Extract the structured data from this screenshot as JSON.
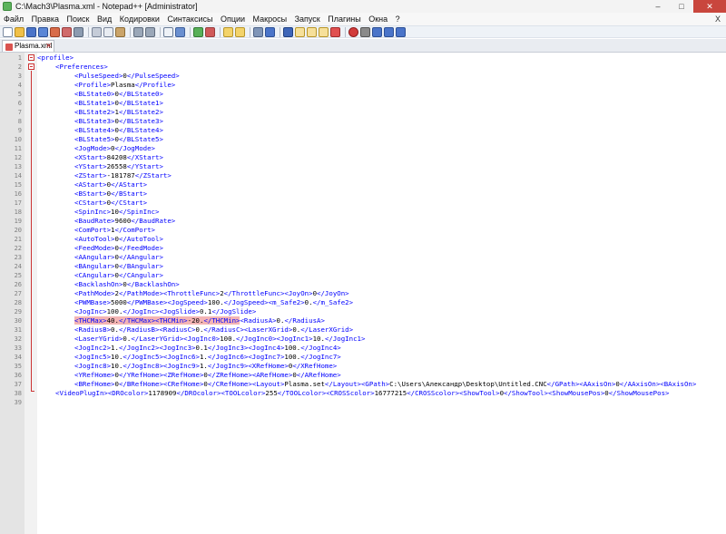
{
  "window": {
    "title": "C:\\Mach3\\Plasma.xml - Notepad++ [Administrator]",
    "buttons": [
      "–",
      "□",
      "✕"
    ]
  },
  "menu": {
    "items": [
      "Файл",
      "Правка",
      "Поиск",
      "Вид",
      "Кодировки",
      "Синтаксисы",
      "Опции",
      "Макросы",
      "Запуск",
      "Плагины",
      "Окна",
      "?"
    ],
    "close": "X"
  },
  "tab": {
    "label": "Plasma.xml",
    "close": "✕"
  },
  "colors": {
    "tag": "#0000ff",
    "text": "#000000",
    "highlight": "#f4b4b4",
    "fold": "#cc3333"
  },
  "lines": [
    {
      "num": "1",
      "segs": [
        [
          "t",
          "<profile>"
        ]
      ]
    },
    {
      "num": "2",
      "segs": [
        [
          "t",
          "<Preferences>"
        ]
      ]
    },
    {
      "num": "3",
      "segs": [
        [
          "t",
          "<PulseSpeed>"
        ],
        [
          "v",
          "0"
        ],
        [
          "t",
          "</PulseSpeed>"
        ]
      ]
    },
    {
      "num": "4",
      "segs": [
        [
          "t",
          "<Profile>"
        ],
        [
          "v",
          "Plasma"
        ],
        [
          "t",
          "</Profile>"
        ]
      ]
    },
    {
      "num": "5",
      "segs": [
        [
          "t",
          "<BLState0>"
        ],
        [
          "v",
          "0"
        ],
        [
          "t",
          "</BLState0>"
        ]
      ]
    },
    {
      "num": "6",
      "segs": [
        [
          "t",
          "<BLState1>"
        ],
        [
          "v",
          "0"
        ],
        [
          "t",
          "</BLState1>"
        ]
      ]
    },
    {
      "num": "7",
      "segs": [
        [
          "t",
          "<BLState2>"
        ],
        [
          "v",
          "1"
        ],
        [
          "t",
          "</BLState2>"
        ]
      ]
    },
    {
      "num": "8",
      "segs": [
        [
          "t",
          "<BLState3>"
        ],
        [
          "v",
          "0"
        ],
        [
          "t",
          "</BLState3>"
        ]
      ]
    },
    {
      "num": "9",
      "segs": [
        [
          "t",
          "<BLState4>"
        ],
        [
          "v",
          "0"
        ],
        [
          "t",
          "</BLState4>"
        ]
      ]
    },
    {
      "num": "10",
      "segs": [
        [
          "t",
          "<BLState5>"
        ],
        [
          "v",
          "0"
        ],
        [
          "t",
          "</BLState5>"
        ]
      ]
    },
    {
      "num": "11",
      "segs": [
        [
          "t",
          "<JogMode>"
        ],
        [
          "v",
          "0"
        ],
        [
          "t",
          "</JogMode>"
        ]
      ]
    },
    {
      "num": "12",
      "segs": [
        [
          "t",
          "<XStart>"
        ],
        [
          "v",
          "84208"
        ],
        [
          "t",
          "</XStart>"
        ]
      ]
    },
    {
      "num": "13",
      "segs": [
        [
          "t",
          "<YStart>"
        ],
        [
          "v",
          "26558"
        ],
        [
          "t",
          "</YStart>"
        ]
      ]
    },
    {
      "num": "14",
      "segs": [
        [
          "t",
          "<ZStart>"
        ],
        [
          "v",
          "-181787"
        ],
        [
          "t",
          "</ZStart>"
        ]
      ]
    },
    {
      "num": "15",
      "segs": [
        [
          "t",
          "<AStart>"
        ],
        [
          "v",
          "0"
        ],
        [
          "t",
          "</AStart>"
        ]
      ]
    },
    {
      "num": "16",
      "segs": [
        [
          "t",
          "<BStart>"
        ],
        [
          "v",
          "0"
        ],
        [
          "t",
          "</BStart>"
        ]
      ]
    },
    {
      "num": "17",
      "segs": [
        [
          "t",
          "<CStart>"
        ],
        [
          "v",
          "0"
        ],
        [
          "t",
          "</CStart>"
        ]
      ]
    },
    {
      "num": "18",
      "segs": [
        [
          "t",
          "<SpinInc>"
        ],
        [
          "v",
          "10"
        ],
        [
          "t",
          "</SpinInc>"
        ]
      ]
    },
    {
      "num": "19",
      "segs": [
        [
          "t",
          "<BaudRate>"
        ],
        [
          "v",
          "9600"
        ],
        [
          "t",
          "</BaudRate>"
        ]
      ]
    },
    {
      "num": "20",
      "segs": [
        [
          "t",
          "<ComPort>"
        ],
        [
          "v",
          "1"
        ],
        [
          "t",
          "</ComPort>"
        ]
      ]
    },
    {
      "num": "21",
      "segs": [
        [
          "t",
          "<AutoTool>"
        ],
        [
          "v",
          "0"
        ],
        [
          "t",
          "</AutoTool>"
        ]
      ]
    },
    {
      "num": "22",
      "segs": [
        [
          "t",
          "<FeedMode>"
        ],
        [
          "v",
          "0"
        ],
        [
          "t",
          "</FeedMode>"
        ]
      ]
    },
    {
      "num": "23",
      "segs": [
        [
          "t",
          "<AAngular>"
        ],
        [
          "v",
          "0"
        ],
        [
          "t",
          "</AAngular>"
        ]
      ]
    },
    {
      "num": "24",
      "segs": [
        [
          "t",
          "<BAngular>"
        ],
        [
          "v",
          "0"
        ],
        [
          "t",
          "</BAngular>"
        ]
      ]
    },
    {
      "num": "25",
      "segs": [
        [
          "t",
          "<CAngular>"
        ],
        [
          "v",
          "0"
        ],
        [
          "t",
          "</CAngular>"
        ]
      ]
    },
    {
      "num": "26",
      "segs": [
        [
          "t",
          "<BacklashOn>"
        ],
        [
          "v",
          "0"
        ],
        [
          "t",
          "</BacklashOn>"
        ]
      ]
    },
    {
      "num": "27",
      "segs": [
        [
          "t",
          "<PathMode>"
        ],
        [
          "v",
          "2"
        ],
        [
          "t",
          "</PathMode>"
        ],
        [
          "t",
          "<ThrottleFunc>"
        ],
        [
          "v",
          "2"
        ],
        [
          "t",
          "</ThrottleFunc>"
        ],
        [
          "t",
          "<JoyOn>"
        ],
        [
          "v",
          "0"
        ],
        [
          "t",
          "</JoyOn>"
        ]
      ]
    },
    {
      "num": "28",
      "segs": [
        [
          "t",
          "<PWMBase>"
        ],
        [
          "v",
          "5000"
        ],
        [
          "t",
          "</PWMBase>"
        ],
        [
          "t",
          "<JogSpeed>"
        ],
        [
          "v",
          "100."
        ],
        [
          "t",
          "</JogSpeed>"
        ],
        [
          "t",
          "<m_Safe2>"
        ],
        [
          "v",
          "0."
        ],
        [
          "t",
          "</m_Safe2>"
        ]
      ]
    },
    {
      "num": "29",
      "segs": [
        [
          "t",
          "<JogInc>"
        ],
        [
          "v",
          "100."
        ],
        [
          "t",
          "</JogInc>"
        ],
        [
          "t",
          "<JogSlide>"
        ],
        [
          "v",
          "0.1"
        ],
        [
          "t",
          "</JogSlide>"
        ]
      ]
    },
    {
      "num": "30",
      "segs": [
        [
          "th",
          "<THCMax>"
        ],
        [
          "vh",
          "40."
        ],
        [
          "th",
          "</THCMax>"
        ],
        [
          "th",
          "<THCMin>"
        ],
        [
          "vh",
          "-20."
        ],
        [
          "th",
          "</THCMin>"
        ],
        [
          "t",
          "<RadiusA>"
        ],
        [
          "v",
          "0."
        ],
        [
          "t",
          "</RadiusA>"
        ]
      ]
    },
    {
      "num": "31",
      "segs": [
        [
          "t",
          "<RadiusB>"
        ],
        [
          "v",
          "0."
        ],
        [
          "t",
          "</RadiusB>"
        ],
        [
          "t",
          "<RadiusC>"
        ],
        [
          "v",
          "0."
        ],
        [
          "t",
          "</RadiusC>"
        ],
        [
          "t",
          "<LaserXGrid>"
        ],
        [
          "v",
          "0."
        ],
        [
          "t",
          "</LaserXGrid>"
        ]
      ]
    },
    {
      "num": "32",
      "segs": [
        [
          "t",
          "<LaserYGrid>"
        ],
        [
          "v",
          "0."
        ],
        [
          "t",
          "</LaserYGrid>"
        ],
        [
          "t",
          "<JogInc0>"
        ],
        [
          "v",
          "100."
        ],
        [
          "t",
          "</JogInc0>"
        ],
        [
          "t",
          "<JogInc1>"
        ],
        [
          "v",
          "10."
        ],
        [
          "t",
          "</JogInc1>"
        ]
      ]
    },
    {
      "num": "33",
      "segs": [
        [
          "t",
          "<JogInc2>"
        ],
        [
          "v",
          "1."
        ],
        [
          "t",
          "</JogInc2>"
        ],
        [
          "t",
          "<JogInc3>"
        ],
        [
          "v",
          "0.1"
        ],
        [
          "t",
          "</JogInc3>"
        ],
        [
          "t",
          "<JogInc4>"
        ],
        [
          "v",
          "100."
        ],
        [
          "t",
          "</JogInc4>"
        ]
      ]
    },
    {
      "num": "34",
      "segs": [
        [
          "t",
          "<JogInc5>"
        ],
        [
          "v",
          "10."
        ],
        [
          "t",
          "</JogInc5>"
        ],
        [
          "t",
          "<JogInc6>"
        ],
        [
          "v",
          "1."
        ],
        [
          "t",
          "</JogInc6>"
        ],
        [
          "t",
          "<JogInc7>"
        ],
        [
          "v",
          "100."
        ],
        [
          "t",
          "</JogInc7>"
        ]
      ]
    },
    {
      "num": "35",
      "segs": [
        [
          "t",
          "<JogInc8>"
        ],
        [
          "v",
          "10."
        ],
        [
          "t",
          "</JogInc8>"
        ],
        [
          "t",
          "<JogInc9>"
        ],
        [
          "v",
          "1."
        ],
        [
          "t",
          "</JogInc9>"
        ],
        [
          "t",
          "<XRefHome>"
        ],
        [
          "v",
          "0"
        ],
        [
          "t",
          "</XRefHome>"
        ]
      ]
    },
    {
      "num": "36",
      "segs": [
        [
          "t",
          "<YRefHome>"
        ],
        [
          "v",
          "0"
        ],
        [
          "t",
          "</YRefHome>"
        ],
        [
          "t",
          "<ZRefHome>"
        ],
        [
          "v",
          "0"
        ],
        [
          "t",
          "</ZRefHome>"
        ],
        [
          "t",
          "<ARefHome>"
        ],
        [
          "v",
          "0"
        ],
        [
          "t",
          "</ARefHome>"
        ]
      ]
    },
    {
      "num": "37",
      "segs": [
        [
          "t",
          "<BRefHome>"
        ],
        [
          "v",
          "0"
        ],
        [
          "t",
          "</BRefHome>"
        ],
        [
          "t",
          "<CRefHome>"
        ],
        [
          "v",
          "0"
        ],
        [
          "t",
          "</CRefHome>"
        ],
        [
          "t",
          "<Layout>"
        ],
        [
          "v",
          "Plasma.set"
        ],
        [
          "t",
          "</Layout>"
        ],
        [
          "t",
          "<GPath>"
        ],
        [
          "v",
          "C:\\Users\\Александр\\Desktop\\Untitled.CNC"
        ],
        [
          "t",
          "</GPath>"
        ],
        [
          "t",
          "<AAxisOn>"
        ],
        [
          "v",
          "0"
        ],
        [
          "t",
          "</AAxisOn>"
        ],
        [
          "t",
          "<BAxisOn>"
        ]
      ]
    },
    {
      "num": "38",
      "segs": [
        [
          "t",
          "<VideoPlugIn>"
        ],
        [
          "t",
          "<DROcolor>"
        ],
        [
          "v",
          "1178909"
        ],
        [
          "t",
          "</DROcolor>"
        ],
        [
          "t",
          "<TOOLcolor>"
        ],
        [
          "v",
          "255"
        ],
        [
          "t",
          "</TOOLcolor>"
        ],
        [
          "t",
          "<CROSScolor>"
        ],
        [
          "v",
          "16777215"
        ],
        [
          "t",
          "</CROSScolor>"
        ],
        [
          "t",
          "<ShowTool>"
        ],
        [
          "v",
          "0"
        ],
        [
          "t",
          "</ShowTool>"
        ],
        [
          "t",
          "<ShowMousePos>"
        ],
        [
          "v",
          "0"
        ],
        [
          "t",
          "</ShowMousePos>"
        ]
      ]
    },
    {
      "num": "39",
      "segs": []
    }
  ]
}
